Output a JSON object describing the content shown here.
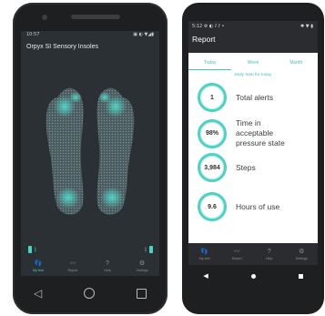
{
  "left_phone": {
    "status_time": "10:57",
    "status_icons": "▣ ◐ ▼◢▮",
    "app_title": "Orpyx SI Sensory Insoles",
    "nav": [
      {
        "label": "My feet",
        "icon": "feet-icon",
        "glyph": "👣",
        "active": true
      },
      {
        "label": "Report",
        "icon": "chart-icon",
        "glyph": "〰",
        "active": false
      },
      {
        "label": "Help",
        "icon": "help-icon",
        "glyph": "?",
        "active": false
      },
      {
        "label": "Settings",
        "icon": "settings-icon",
        "glyph": "⚙",
        "active": false
      }
    ],
    "accent": "#4fd1c5"
  },
  "right_phone": {
    "status_time": "5:12",
    "status_icons_left": "⚙ ◐ ⫽ ⫽ •",
    "status_icons_right": "✱ ▼ ▮",
    "header_title": "Report",
    "tabs": [
      "Today",
      "Week",
      "Month"
    ],
    "active_tab": "Today",
    "daily_caption": "Daily total for today",
    "metrics": [
      {
        "value": "1",
        "label": "Total alerts"
      },
      {
        "value": "98%",
        "label": "Time in acceptable pressure state"
      },
      {
        "value": "3,984",
        "label": "Steps"
      },
      {
        "value": "9.6",
        "label": "Hours of use"
      }
    ],
    "nav": [
      {
        "label": "My feet",
        "glyph": "👣"
      },
      {
        "label": "Report",
        "glyph": "〰"
      },
      {
        "label": "Help",
        "glyph": "?"
      },
      {
        "label": "Settings",
        "glyph": "⚙"
      }
    ],
    "accent": "#4fd1c5"
  }
}
